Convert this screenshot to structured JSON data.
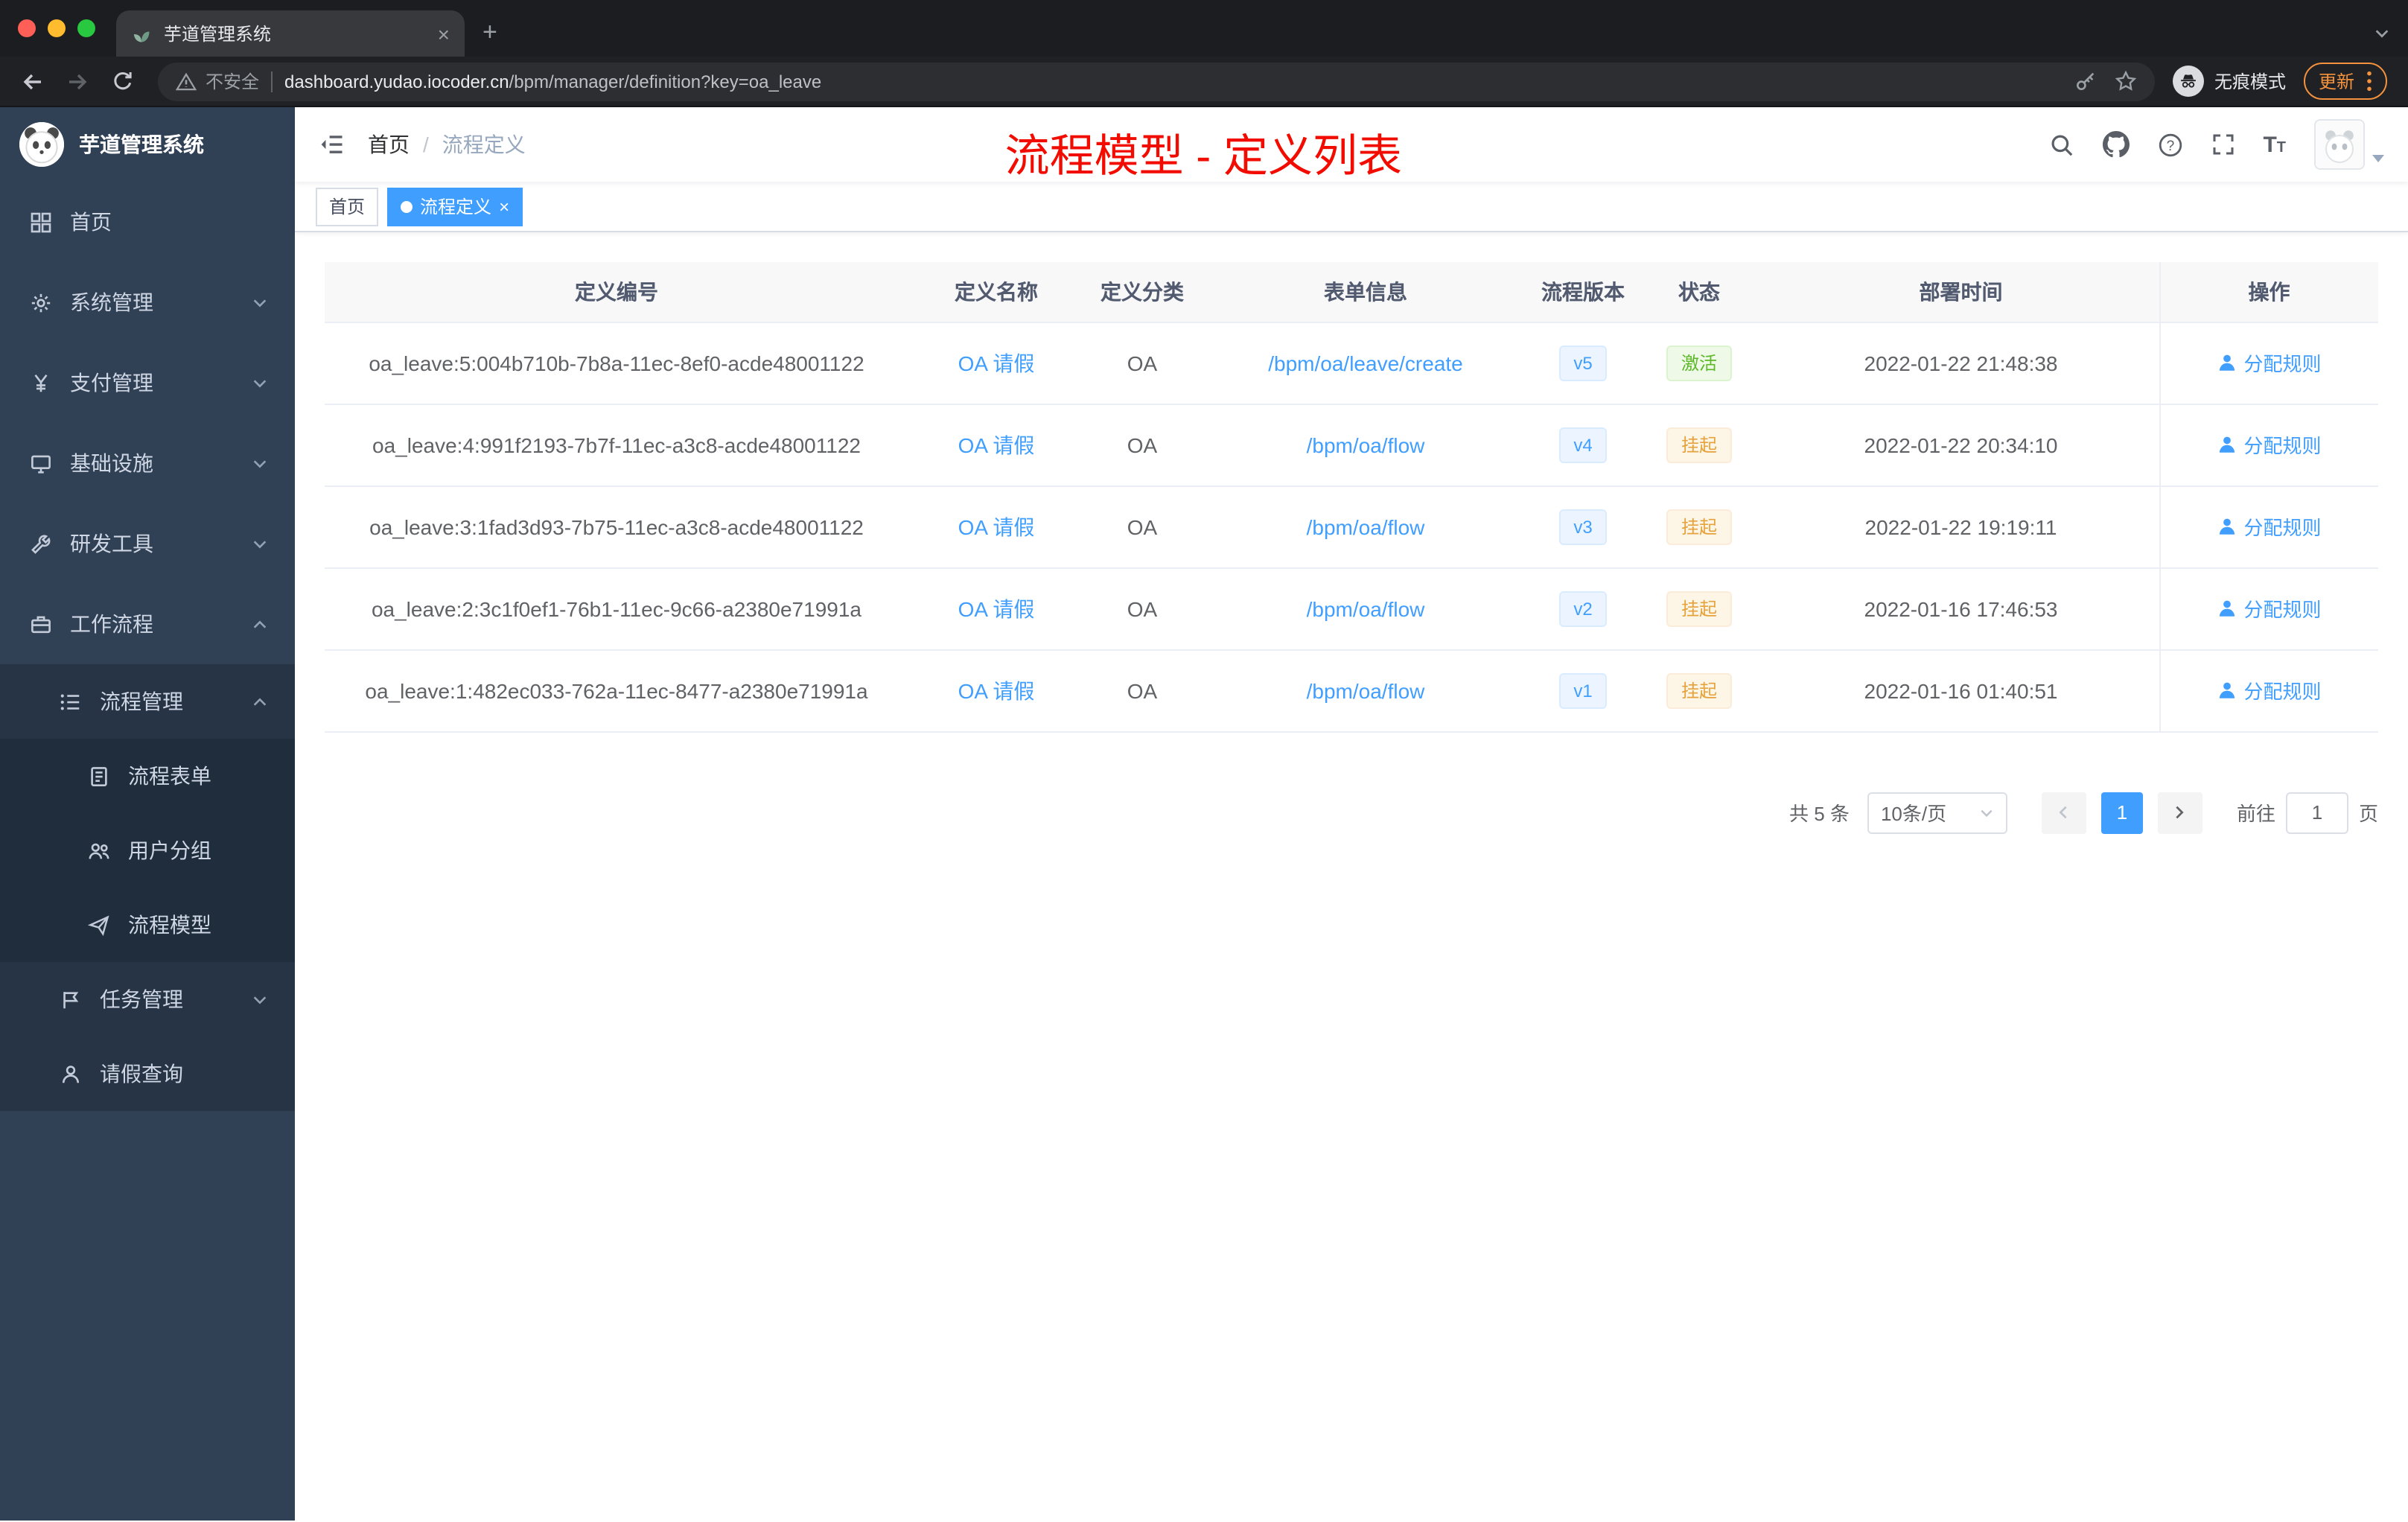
{
  "colors": {
    "accent": "#409eff",
    "success": "#5cb826",
    "warning": "#e6a23c",
    "annotation_red": "#f20c00",
    "sidebar_bg": "#304156"
  },
  "icons": {
    "search": "magnifier",
    "github": "octocat-mark",
    "help": "question-circle",
    "fullscreen": "expand-corners",
    "font_size": "Tt glyph",
    "hamburger": "menu-fold",
    "warning": "triangle-exclamation",
    "incognito": "hat-and-glasses",
    "assign": "user-silhouette",
    "chevron": "caret"
  },
  "browser": {
    "tab_title": "芋道管理系统",
    "tab_close": "×",
    "new_tab": "+",
    "security_label": "不安全",
    "url_domain": "dashboard.yudao.iocoder.cn",
    "url_path": "/bpm/manager/definition?key=oa_leave",
    "incognito_label": "无痕模式",
    "update_label": "更新"
  },
  "sidebar": {
    "logo_title": "芋道管理系统",
    "items": [
      {
        "label": "首页"
      },
      {
        "label": "系统管理"
      },
      {
        "label": "支付管理"
      },
      {
        "label": "基础设施"
      },
      {
        "label": "研发工具"
      },
      {
        "label": "工作流程"
      },
      {
        "label": "流程管理"
      },
      {
        "label": "流程表单"
      },
      {
        "label": "用户分组"
      },
      {
        "label": "流程模型"
      },
      {
        "label": "任务管理"
      },
      {
        "label": "请假查询"
      }
    ]
  },
  "navbar": {
    "breadcrumb_home": "首页",
    "breadcrumb_sep": "/",
    "breadcrumb_current": "流程定义",
    "annotation": "流程模型 - 定义列表"
  },
  "tags": {
    "home": "首页",
    "current": "流程定义",
    "close": "×"
  },
  "table": {
    "headers": [
      "定义编号",
      "定义名称",
      "定义分类",
      "表单信息",
      "流程版本",
      "状态",
      "部署时间",
      "操作"
    ],
    "action_label": "分配规则",
    "rows": [
      {
        "id": "oa_leave:5:004b710b-7b8a-11ec-8ef0-acde48001122",
        "name": "OA 请假",
        "category": "OA",
        "form": "/bpm/oa/leave/create",
        "version": "v5",
        "status": "激活",
        "time": "2022-01-22 21:48:38"
      },
      {
        "id": "oa_leave:4:991f2193-7b7f-11ec-a3c8-acde48001122",
        "name": "OA 请假",
        "category": "OA",
        "form": "/bpm/oa/flow",
        "version": "v4",
        "status": "挂起",
        "time": "2022-01-22 20:34:10"
      },
      {
        "id": "oa_leave:3:1fad3d93-7b75-11ec-a3c8-acde48001122",
        "name": "OA 请假",
        "category": "OA",
        "form": "/bpm/oa/flow",
        "version": "v3",
        "status": "挂起",
        "time": "2022-01-22 19:19:11"
      },
      {
        "id": "oa_leave:2:3c1f0ef1-76b1-11ec-9c66-a2380e71991a",
        "name": "OA 请假",
        "category": "OA",
        "form": "/bpm/oa/flow",
        "version": "v2",
        "status": "挂起",
        "time": "2022-01-16 17:46:53"
      },
      {
        "id": "oa_leave:1:482ec033-762a-11ec-8477-a2380e71991a",
        "name": "OA 请假",
        "category": "OA",
        "form": "/bpm/oa/flow",
        "version": "v1",
        "status": "挂起",
        "time": "2022-01-16 01:40:51"
      }
    ]
  },
  "pagination": {
    "total": "共 5 条",
    "page_size": "10条/页",
    "current_page": "1",
    "goto_label": "前往",
    "goto_value": "1",
    "page_unit": "页"
  }
}
